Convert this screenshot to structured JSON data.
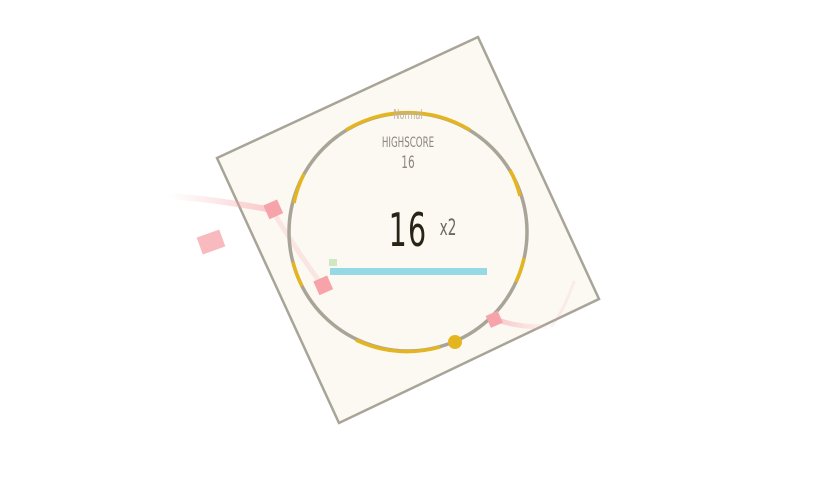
{
  "hud": {
    "mode": "Normal",
    "highscore_label": "HIGHSCORE",
    "highscore_value": "16",
    "score": "16",
    "multiplier": "x2"
  },
  "timer": {
    "remaining_fraction": 1.0
  },
  "colors": {
    "board_fill": "#fcf8f2",
    "board_border": "#a8a498",
    "ring": "#a8a498",
    "ring_accent": "#e5b51f",
    "player": "#e5b51f",
    "timer_bar": "#94d9e4",
    "pickup": "#cfe8c4",
    "enemy": "#f7a3aa"
  },
  "icons": {
    "player": "player-dot-icon",
    "enemy": "enemy-square-icon",
    "pickup": "pickup-square-icon"
  }
}
